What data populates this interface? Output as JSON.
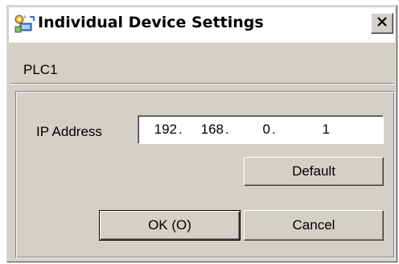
{
  "window": {
    "title": "Individual Device Settings",
    "icon": "settings-icon",
    "close_icon": "close-icon"
  },
  "device": {
    "name": "PLC1"
  },
  "ip": {
    "label": "IP Address",
    "octets": [
      "192",
      "168",
      "0",
      "1"
    ],
    "separator": "."
  },
  "buttons": {
    "default_label": "Default",
    "ok_label": "OK (O)",
    "cancel_label": "Cancel"
  },
  "colors": {
    "dialog_bg": "#d4d0c8",
    "titlebar_bg": "#ffffff"
  }
}
